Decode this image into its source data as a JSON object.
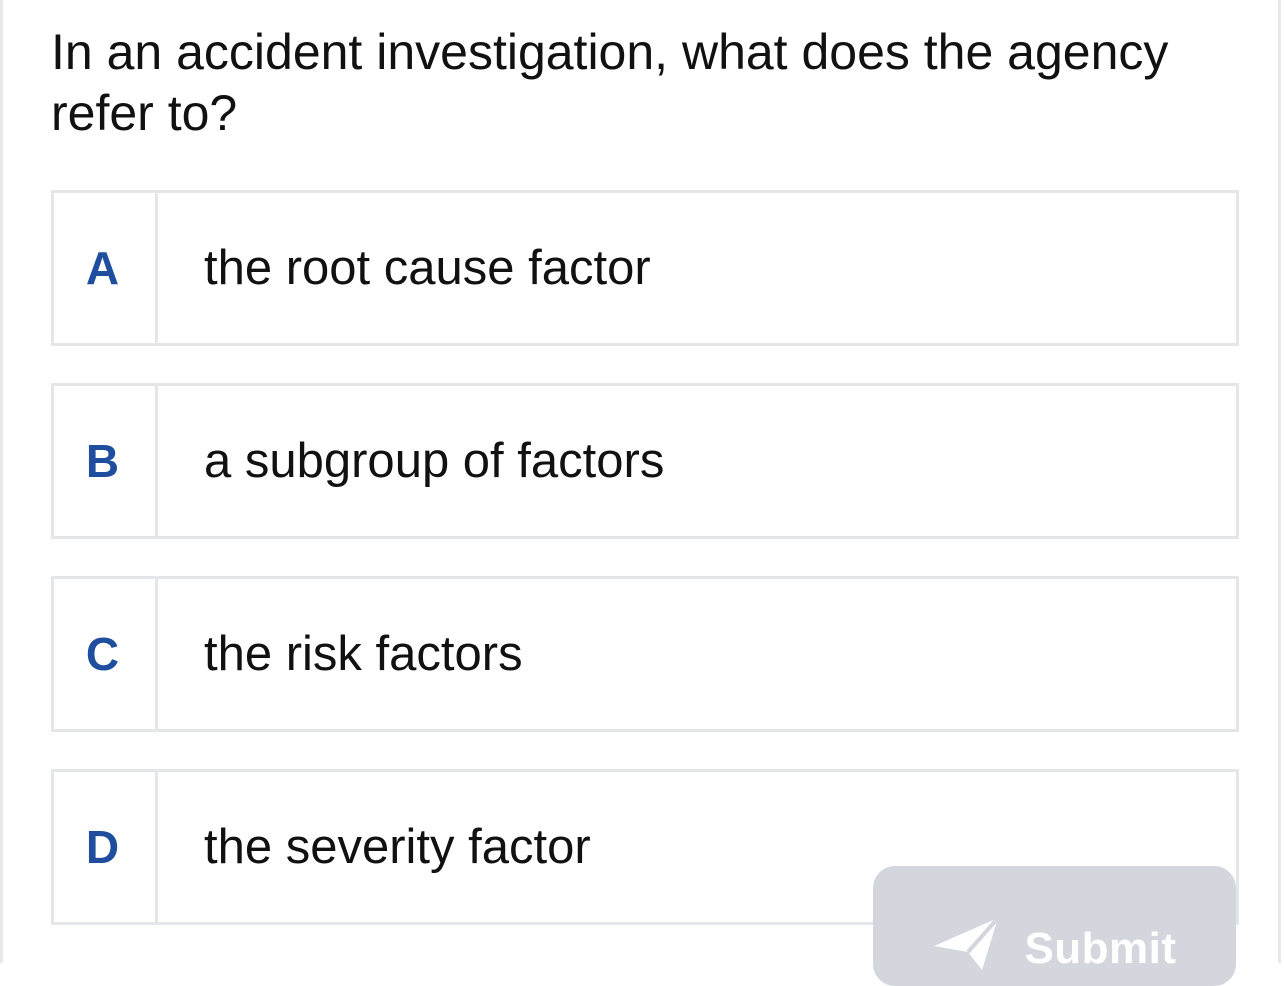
{
  "question": {
    "text": "In an accident investigation, what does the agency refer to?"
  },
  "options": [
    {
      "letter": "A",
      "text": "the root cause factor"
    },
    {
      "letter": "B",
      "text": "a subgroup of factors"
    },
    {
      "letter": "C",
      "text": "the risk factors"
    },
    {
      "letter": "D",
      "text": "the severity factor"
    }
  ],
  "submit": {
    "label": "Submit",
    "icon": "send-icon"
  },
  "colors": {
    "letter": "#1f4e9e",
    "border": "#e4e6ea",
    "submit_bg": "#d3d6dd",
    "submit_text": "#ffffff"
  }
}
